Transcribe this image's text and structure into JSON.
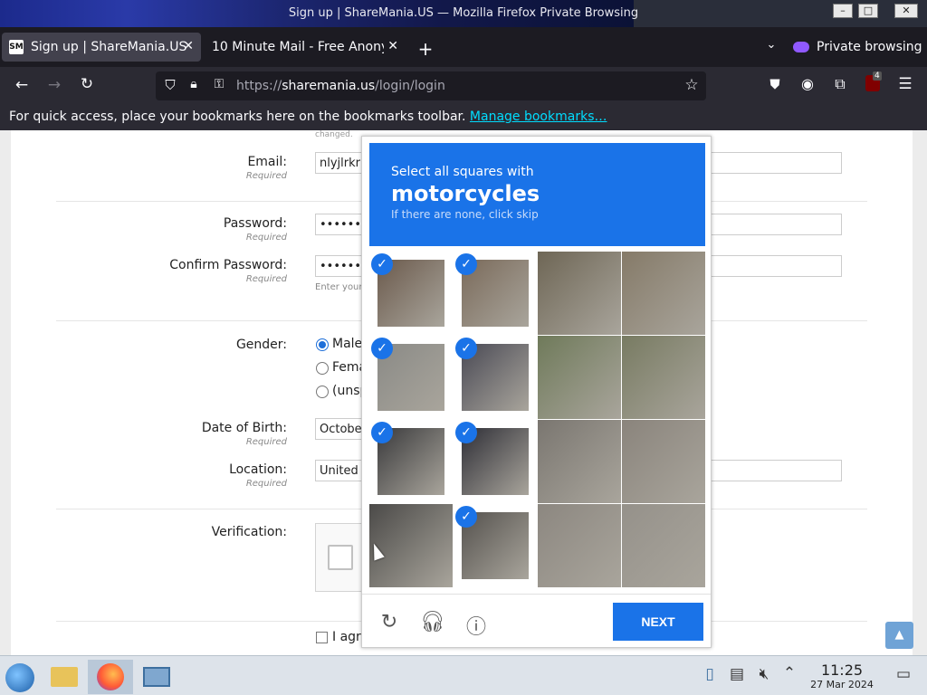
{
  "window": {
    "title": "Sign up | ShareMania.US — Mozilla Firefox Private Browsing"
  },
  "tabs": [
    {
      "label": "Sign up | ShareMania.US",
      "favicon": "SM"
    },
    {
      "label": "10 Minute Mail - Free Anony"
    }
  ],
  "private_label": "Private browsing",
  "url": {
    "prefix": "https://",
    "host": "sharemania.us",
    "path": "/login/login"
  },
  "bookmarks_bar": {
    "text": "For quick access, place your bookmarks here on the bookmarks toolbar.",
    "link": "Manage bookmarks…"
  },
  "extension_badge": "4",
  "form": {
    "changed_note": "changed.",
    "email": {
      "label": "Email:",
      "req": "Required",
      "value": "nlyjlrkrk"
    },
    "password": {
      "label": "Password:",
      "req": "Required",
      "value": "••••••"
    },
    "confirm": {
      "label": "Confirm Password:",
      "req": "Required",
      "value": "••••••",
      "hint": "Enter your"
    },
    "gender": {
      "label": "Gender:",
      "options": [
        "Male",
        "Fema",
        "(unsp"
      ]
    },
    "dob": {
      "label": "Date of Birth:",
      "req": "Required",
      "value": "October"
    },
    "location": {
      "label": "Location:",
      "req": "Required",
      "value": "United S"
    },
    "verification": {
      "label": "Verification:"
    },
    "agree": "I agre"
  },
  "captcha": {
    "line1": "Select all squares with",
    "line2": "motorcycles",
    "line3": "If there are none, click skip",
    "next": "NEXT",
    "selected_tiles": [
      0,
      1,
      4,
      5,
      8,
      9,
      13
    ]
  },
  "clock": {
    "time": "11:25",
    "date": "27 Mar 2024"
  },
  "colors": {
    "accent": "#1a73e8",
    "firefox_dark": "#1c1b22"
  }
}
